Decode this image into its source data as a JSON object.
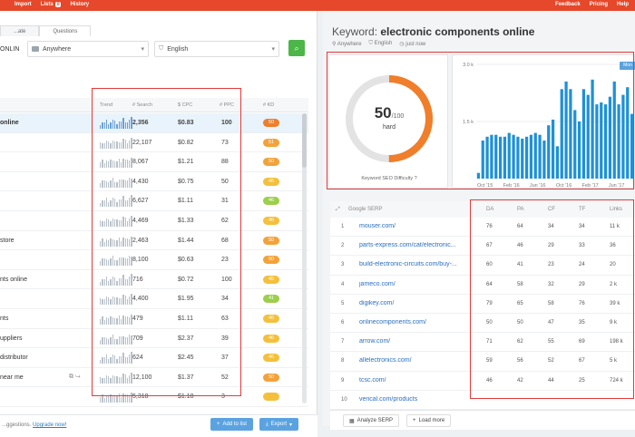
{
  "topbar": {
    "nav": [
      "Import",
      "Lists",
      "History"
    ],
    "lists_count": "0",
    "right": [
      "Feedback",
      "Pricing",
      "Help"
    ]
  },
  "tabs": [
    "...ate",
    "Questions"
  ],
  "search": {
    "keyword_fragment": "ONLIN",
    "location": "Anywhere",
    "language": "English"
  },
  "table": {
    "headers": [
      "Trend",
      "# Search",
      "$ CPC",
      "# PPC",
      "# KD"
    ],
    "rows": [
      {
        "kw": "online",
        "search": "2,356",
        "cpc": "$0.83",
        "ppc": "100",
        "kd": "50",
        "kd_color": "#f07e2a"
      },
      {
        "kw": "",
        "search": "22,107",
        "cpc": "$0.82",
        "ppc": "73",
        "kd": "51",
        "kd_color": "#f3a23a"
      },
      {
        "kw": "",
        "search": "8,067",
        "cpc": "$1.21",
        "ppc": "88",
        "kd": "50",
        "kd_color": "#f3a23a"
      },
      {
        "kw": "",
        "search": "4,430",
        "cpc": "$0.75",
        "ppc": "50",
        "kd": "45",
        "kd_color": "#f4c03c"
      },
      {
        "kw": "",
        "search": "6,627",
        "cpc": "$1.11",
        "ppc": "31",
        "kd": "46",
        "kd_color": "#9ccf4a"
      },
      {
        "kw": "",
        "search": "4,469",
        "cpc": "$1.33",
        "ppc": "62",
        "kd": "46",
        "kd_color": "#f4c03c"
      },
      {
        "kw": "store",
        "search": "2,463",
        "cpc": "$1.44",
        "ppc": "68",
        "kd": "50",
        "kd_color": "#f3a23a"
      },
      {
        "kw": "",
        "search": "8,100",
        "cpc": "$0.63",
        "ppc": "23",
        "kd": "50",
        "kd_color": "#f3a23a"
      },
      {
        "kw": "nts online",
        "search": "716",
        "cpc": "$0.72",
        "ppc": "100",
        "kd": "45",
        "kd_color": "#f4c03c"
      },
      {
        "kw": "",
        "search": "4,400",
        "cpc": "$1.95",
        "ppc": "34",
        "kd": "41",
        "kd_color": "#9ccf4a"
      },
      {
        "kw": "nts",
        "search": "479",
        "cpc": "$1.11",
        "ppc": "63",
        "kd": "46",
        "kd_color": "#f4c03c"
      },
      {
        "kw": "uppliers",
        "search": "709",
        "cpc": "$2.37",
        "ppc": "39",
        "kd": "46",
        "kd_color": "#f4c03c"
      },
      {
        "kw": "distributor",
        "search": "624",
        "cpc": "$2.45",
        "ppc": "37",
        "kd": "46",
        "kd_color": "#f4c03c"
      },
      {
        "kw": "near me",
        "search": "12,100",
        "cpc": "$1.37",
        "ppc": "52",
        "kd": "50",
        "kd_color": "#f3a23a"
      },
      {
        "kw": "",
        "search": "5,318",
        "cpc": "$1.18",
        "ppc": "3",
        "kd": "",
        "kd_color": "#f4c03c"
      }
    ]
  },
  "footer_left": {
    "suggestions": "...ggestions.",
    "upgrade": "Upgrade now!",
    "add_to_list": "Add to list",
    "export": "Export"
  },
  "keyword": {
    "label": "Keyword:",
    "value": "electronic components online",
    "location": "Anywhere",
    "language": "English",
    "time": "just now"
  },
  "difficulty": {
    "value": "50",
    "max": "/100",
    "level": "hard",
    "label": "Keyword SEO Difficulty",
    "fraction": 0.5
  },
  "chart_data": {
    "type": "bar",
    "title": "",
    "ylim": [
      0,
      3000
    ],
    "yticks": [
      "3.0 k",
      "1.5 k"
    ],
    "xticks": [
      "Oct '15",
      "Feb '16",
      "Jun '16",
      "Oct '16",
      "Feb '17",
      "Jun '17"
    ],
    "values": [
      150,
      1000,
      1100,
      1150,
      1150,
      1100,
      1100,
      1200,
      1150,
      1100,
      1050,
      1100,
      1150,
      1200,
      1150,
      1000,
      1400,
      1550,
      850,
      2350,
      2550,
      2350,
      1800,
      1500,
      2350,
      2200,
      2600,
      1950,
      2000,
      1950,
      2150,
      2550,
      1950,
      2200,
      2400,
      1700
    ],
    "toggle": "Mon"
  },
  "serp": {
    "title": "Google SERP",
    "headers": [
      "DA",
      "PA",
      "CF",
      "TF",
      "Links"
    ],
    "rows": [
      {
        "n": "1",
        "url": "mouser.com/",
        "da": "76",
        "pa": "64",
        "cf": "34",
        "tf": "34",
        "links": "11 k"
      },
      {
        "n": "2",
        "url": "parts-express.com/cat/electronic...",
        "da": "67",
        "pa": "46",
        "cf": "29",
        "tf": "33",
        "links": "36"
      },
      {
        "n": "3",
        "url": "build-electronic-circuits.com/buy-...",
        "da": "60",
        "pa": "41",
        "cf": "23",
        "tf": "24",
        "links": "20"
      },
      {
        "n": "4",
        "url": "jameco.com/",
        "da": "64",
        "pa": "58",
        "cf": "32",
        "tf": "29",
        "links": "2 k"
      },
      {
        "n": "5",
        "url": "digikey.com/",
        "da": "79",
        "pa": "65",
        "cf": "58",
        "tf": "76",
        "links": "39 k"
      },
      {
        "n": "6",
        "url": "onlinecomponents.com/",
        "da": "50",
        "pa": "50",
        "cf": "47",
        "tf": "35",
        "links": "9 k"
      },
      {
        "n": "7",
        "url": "arrow.com/",
        "da": "71",
        "pa": "62",
        "cf": "55",
        "tf": "69",
        "links": "198 k"
      },
      {
        "n": "8",
        "url": "allelectronics.com/",
        "da": "59",
        "pa": "56",
        "cf": "52",
        "tf": "67",
        "links": "5 k"
      },
      {
        "n": "9",
        "url": "tcsc.com/",
        "da": "46",
        "pa": "42",
        "cf": "44",
        "tf": "25",
        "links": "724 k"
      },
      {
        "n": "10",
        "url": "verical.com/products",
        "da": "",
        "pa": "",
        "cf": "",
        "tf": "",
        "links": ""
      }
    ],
    "analyze": "Analyze SERP",
    "load_more": "Load more"
  }
}
